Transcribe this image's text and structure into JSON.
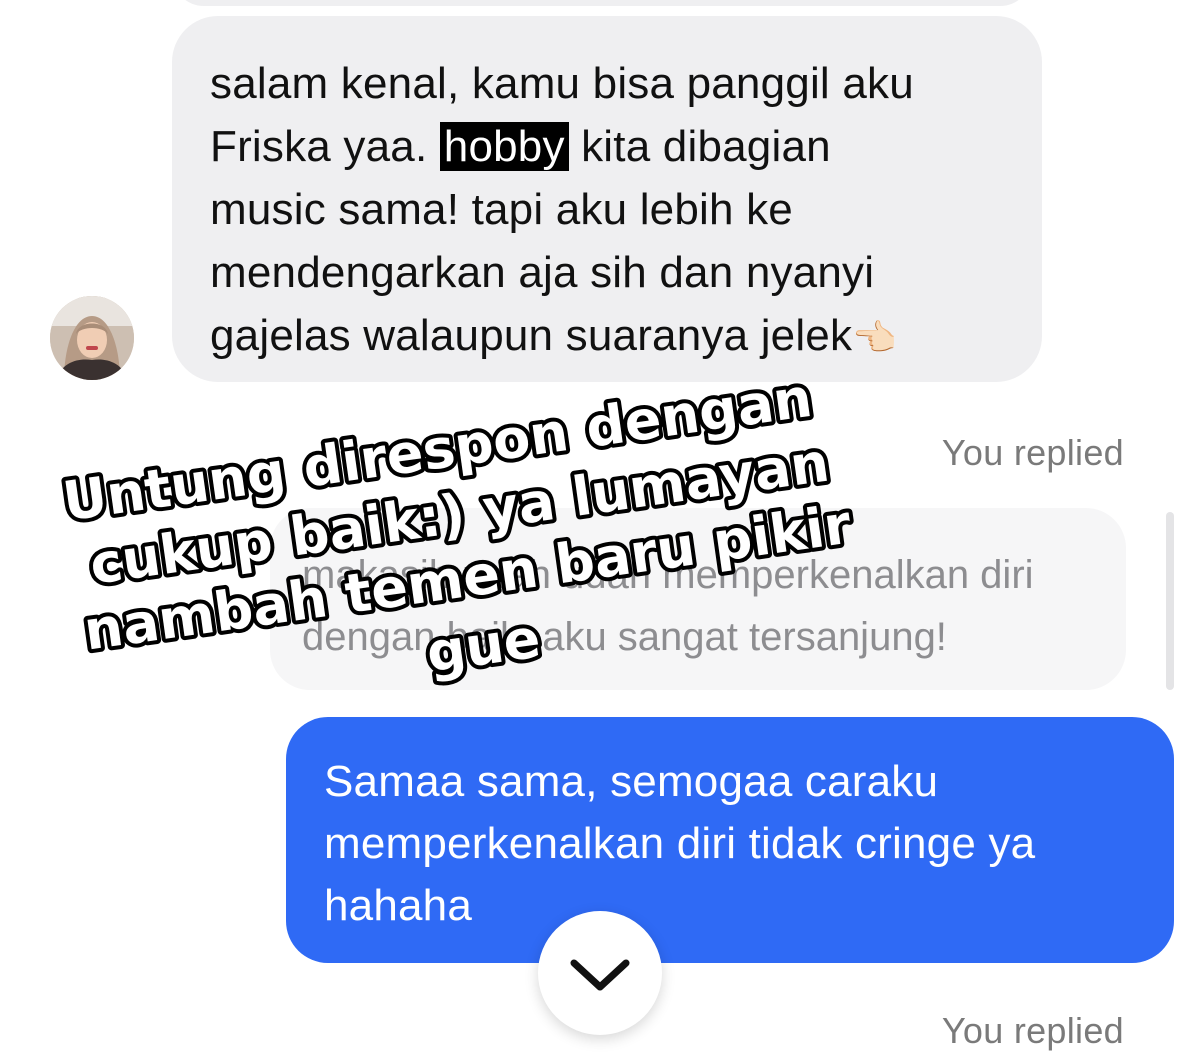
{
  "thread": {
    "incoming_message": {
      "line1": "salam kenal, kamu bisa panggil aku",
      "line2_before": "Friska yaa. ",
      "line2_highlight": "hobby",
      "line2_after": " kita dibagian",
      "line3": "music sama! tapi aku lebih ke",
      "line4": "mendengarkan aja sih dan nyanyi",
      "line5": "gajelas walaupun suaranya jelek",
      "emoji": "👈🏻"
    },
    "reply_label_1": "You replied",
    "quoted_message": {
      "line1": "makasih udah udah memperkenalkan diri",
      "line2": "dengan baik, aku sangat tersanjung!"
    },
    "outgoing_message": {
      "line1": "Samaa sama, semogaa caraku",
      "line2": "memperkenalkan diri tidak cringe ya",
      "line3": "hahaha"
    },
    "reply_label_2": "You replied"
  },
  "caption_overlay": {
    "line1": "Untung direspon dengan",
    "line2": "cukup baik:) ya lumayan",
    "line3": "nambah temen baru pikir",
    "line4": "gue"
  },
  "icons": {
    "scroll_down": "chevron-down-icon",
    "avatar": "profile-photo"
  },
  "colors": {
    "incoming_bubble": "#efeff1",
    "outgoing_bubble": "#2f6af5",
    "quoted_bubble": "#f6f6f7",
    "label_gray": "#7a7a7a"
  }
}
